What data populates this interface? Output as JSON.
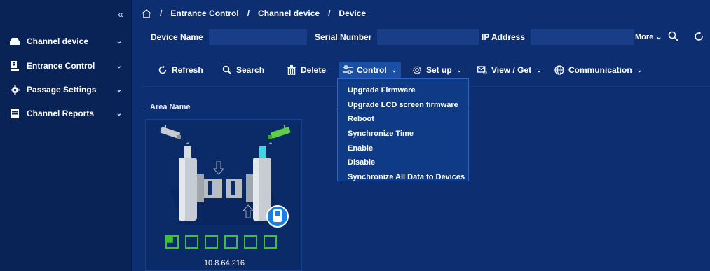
{
  "sidebar": {
    "collapse_icon": "double-chevron-left-icon",
    "items": [
      {
        "label": "Channel device",
        "icon": "channel-device-icon"
      },
      {
        "label": "Entrance Control",
        "icon": "entrance-control-icon"
      },
      {
        "label": "Passage Settings",
        "icon": "gear-icon"
      },
      {
        "label": "Channel Reports",
        "icon": "report-icon"
      }
    ]
  },
  "breadcrumb": {
    "home_icon": "home-icon",
    "separator": "/",
    "items": [
      "Entrance Control",
      "Channel device",
      "Device"
    ]
  },
  "filters": {
    "device_name_label": "Device Name",
    "serial_number_label": "Serial Number",
    "ip_address_label": "IP Address",
    "more_label": "More"
  },
  "toolbar": {
    "refresh": "Refresh",
    "search": "Search",
    "delete": "Delete",
    "control": "Control",
    "setup": "Set up",
    "view_get": "View / Get",
    "communication": "Communication"
  },
  "control_menu": [
    "Upgrade Firmware",
    "Upgrade LCD screen firmware",
    "Reboot",
    "Synchronize Time",
    "Enable",
    "Disable",
    "Synchronize All Data to Devices"
  ],
  "area": {
    "label": "Area Name",
    "device_ip": "10.8.64.216",
    "device_icons": [
      "door-icon",
      "grid-icon",
      "list-icon",
      "sort-icon",
      "calendar-icon",
      "sync-icon"
    ]
  },
  "colors": {
    "background": "#0d2f72",
    "sidebar": "#0a2356",
    "accent_green": "#3fbf3a",
    "active_button": "#1a4fa3"
  }
}
